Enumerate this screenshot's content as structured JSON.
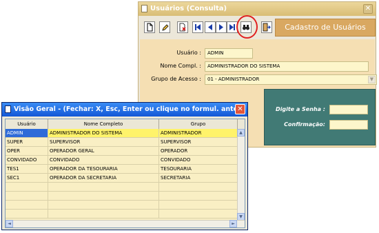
{
  "consulta_window": {
    "title": "Usuários (Consulta)",
    "close_glyph": "✕",
    "header_label": "Cadastro de Usuários",
    "toolbar": {
      "icons": [
        "new-document-icon",
        "edit-pencil-icon",
        "delete-icon",
        "first-record-icon",
        "previous-record-icon",
        "next-record-icon",
        "last-record-icon",
        "search-binoculars-icon",
        "exit-door-icon"
      ]
    },
    "form": {
      "usuario_label": "Usuário :",
      "usuario_value": "ADMIN",
      "nome_label": "Nome Compl. :",
      "nome_value": "ADMINISTRADOR DO SISTEMA",
      "grupo_label": "Grupo de Acesso :",
      "grupo_value": "01 - ADMINISTRADOR",
      "dropdown_glyph": "▼"
    },
    "password_panel": {
      "senha_label": "Digite a Senha :",
      "confirm_label": "Confirmação:"
    }
  },
  "visao_window": {
    "title": "Visão Geral - (Fechar: X, Esc, Enter ou clique no formul. ante...",
    "close_glyph": "✕",
    "columns": [
      "Usuário",
      "Nome Completo",
      "Grupo"
    ],
    "rows": [
      {
        "usuario": "ADMIN",
        "nome": "ADMINISTRADOR DO SISTEMA",
        "grupo": "ADMINISTRADOR"
      },
      {
        "usuario": "SUPER",
        "nome": "SUPERVISOR",
        "grupo": "SUPERVISOR"
      },
      {
        "usuario": "OPER",
        "nome": "OPERADOR GERAL",
        "grupo": "OPERADOR"
      },
      {
        "usuario": "CONVIDADO",
        "nome": "CONVIDADO",
        "grupo": "CONVIDADO"
      },
      {
        "usuario": "TES1",
        "nome": "OPERADOR DA TESOURARIA",
        "grupo": "TESOURARIA"
      },
      {
        "usuario": "SEC1",
        "nome": "OPERADOR DA SECRETARIA",
        "grupo": "SECRETARIA"
      }
    ],
    "selected_row": 0,
    "scroll_up": "▲",
    "scroll_down": "▼",
    "scroll_left": "◄",
    "scroll_right": "►"
  },
  "colors": {
    "back_titlebar": "#d9bd75",
    "header_label_bg": "#d9a861",
    "form_bg": "#f5dfb3",
    "password_panel_bg": "#417a75",
    "front_titlebar": "#1257d6",
    "grid_bg": "#f9efc4",
    "selected_cell": "#2f6bd8",
    "selected_row": "#fff36a",
    "highlight_ring": "#e02020"
  }
}
